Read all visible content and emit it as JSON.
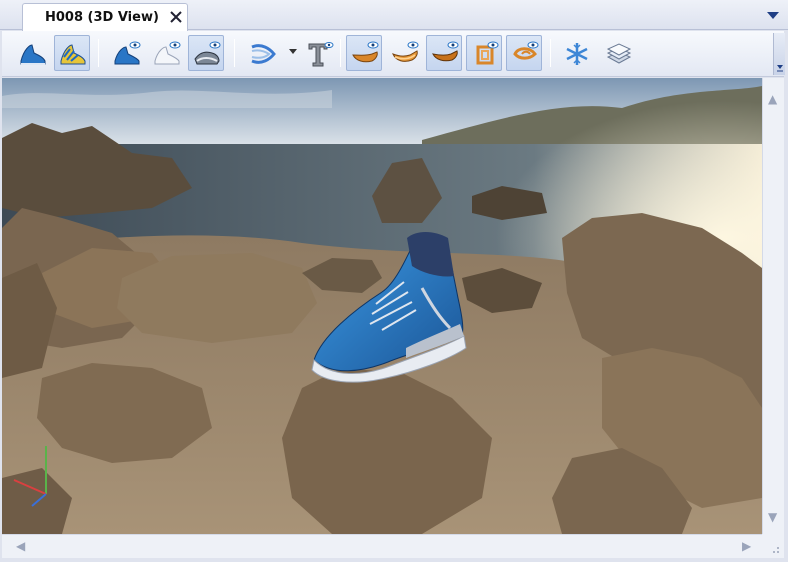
{
  "tab": {
    "title": "H008 (3D View)"
  },
  "toolbar": {
    "buttons": [
      {
        "icon": "shoe-blue-icon",
        "active": false
      },
      {
        "icon": "shoe-textured-icon",
        "active": true
      },
      {
        "icon": "shoe-visibility-icon",
        "active": false
      },
      {
        "icon": "shoe-white-icon",
        "active": false
      },
      {
        "icon": "shoe-sole-visibility-icon",
        "active": true
      },
      {
        "icon": "curve-tool-icon",
        "active": false
      },
      {
        "icon": "text-tool-icon",
        "active": false
      },
      {
        "icon": "insole-orange-icon",
        "active": true
      },
      {
        "icon": "sole-orange-icon",
        "active": false
      },
      {
        "icon": "sole-orange-2-icon",
        "active": true
      },
      {
        "icon": "heel-counter-icon",
        "active": true
      },
      {
        "icon": "toe-cap-icon",
        "active": true
      },
      {
        "icon": "snowflake-icon",
        "active": false
      },
      {
        "icon": "layers-icon",
        "active": false
      }
    ]
  },
  "colors": {
    "accent": "#2a76c6",
    "sole": "#d9862a",
    "window_bg": "#dfe3ee"
  }
}
